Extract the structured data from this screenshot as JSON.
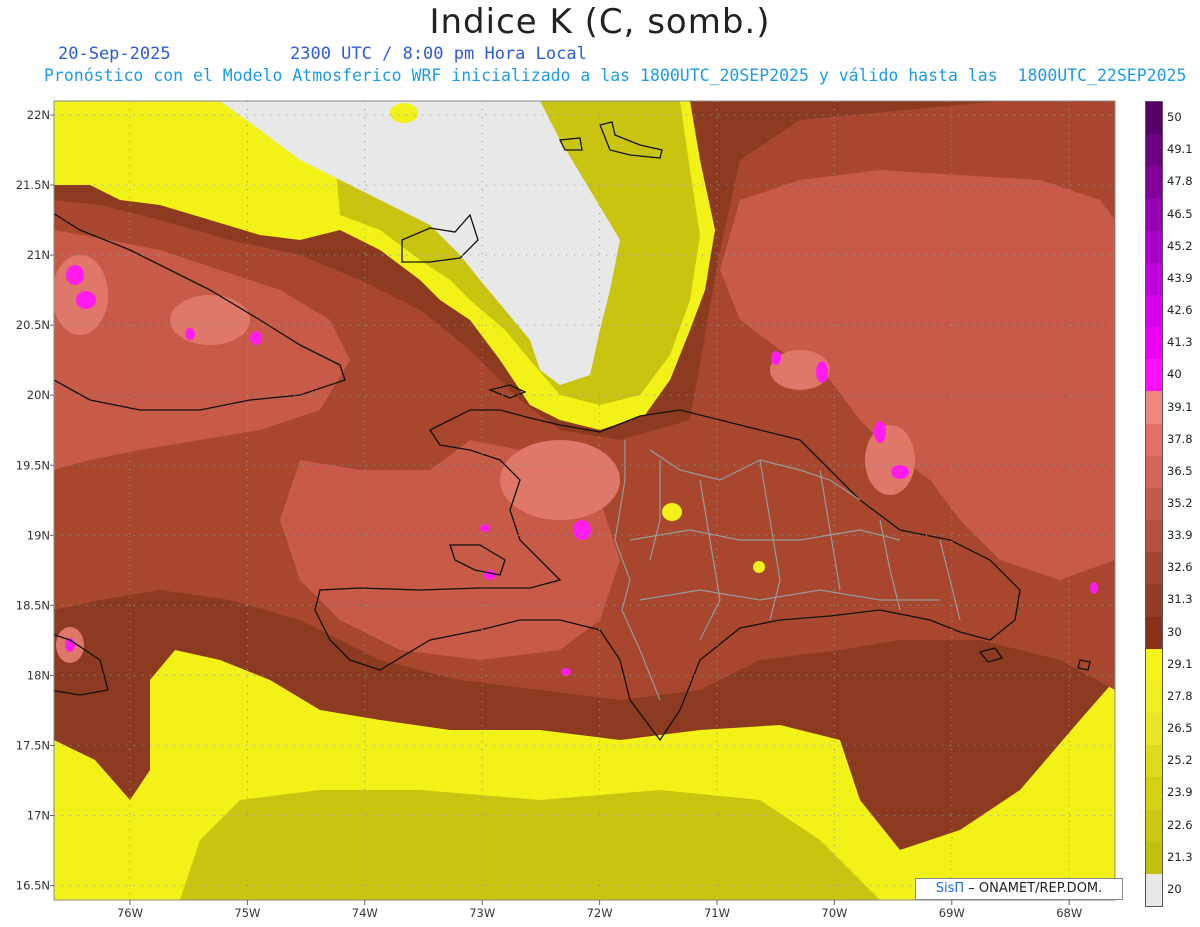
{
  "header": {
    "title": "Indice K (C, somb.)",
    "date": "20-Sep-2025",
    "time": "2300 UTC / 8:00 pm Hora Local",
    "subtitle": "Pronóstico con el Modelo Atmosferico WRF inicializado a las 1800UTC_20SEP2025 y válido hasta las  1800UTC_22SEP2025"
  },
  "map": {
    "lat_labels": [
      "22N",
      "21.5N",
      "21N",
      "20.5N",
      "20N",
      "19.5N",
      "19N",
      "18.5N",
      "18N",
      "17.5N",
      "17N",
      "16.5N"
    ],
    "lon_labels": [
      "76W",
      "75W",
      "74W",
      "73W",
      "72W",
      "71W",
      "70W",
      "69W",
      "68W"
    ],
    "lat_values": [
      22,
      21.5,
      21,
      20.5,
      20,
      19.5,
      19,
      18.5,
      18,
      17.5,
      17,
      16.5
    ],
    "lon_values": [
      -76,
      -75,
      -74,
      -73,
      -72,
      -71,
      -70,
      -69,
      -68
    ],
    "colors": {
      "no_data": "#e8e8e8",
      "yellow": "#f2f218",
      "olive": "#c8c410",
      "dark_brown": "#8c3a20",
      "mid_brown": "#a8472e",
      "salmon": "#c85a48",
      "pink": "#e0786a",
      "magenta": "#ff1cf0",
      "coast": "#111111",
      "borders": "#9a9a9a"
    }
  },
  "credit": {
    "sis": "SisΠ",
    "rest": " – ONAMET/REP.DOM."
  },
  "colorbar": {
    "labels": [
      "50",
      "49.1",
      "47.8",
      "46.5",
      "45.2",
      "43.9",
      "42.6",
      "41.3",
      "40",
      "39.1",
      "37.8",
      "36.5",
      "35.2",
      "33.9",
      "32.6",
      "31.3",
      "30",
      "29.1",
      "27.8",
      "26.5",
      "25.2",
      "23.9",
      "22.6",
      "21.3",
      "20"
    ],
    "colors": [
      "#5a006a",
      "#6e0082",
      "#82009a",
      "#9600b4",
      "#aa00cc",
      "#c000dc",
      "#d400ea",
      "#ea00f4",
      "#ff10ff",
      "#f08880",
      "#e2706a",
      "#d2645a",
      "#c45a4c",
      "#b44e3e",
      "#a44432",
      "#963a28",
      "#863018",
      "#f4f418",
      "#eeee20",
      "#e8e628",
      "#deda20",
      "#d4d018",
      "#cac810",
      "#c0c010",
      "#e8e8e8"
    ]
  }
}
